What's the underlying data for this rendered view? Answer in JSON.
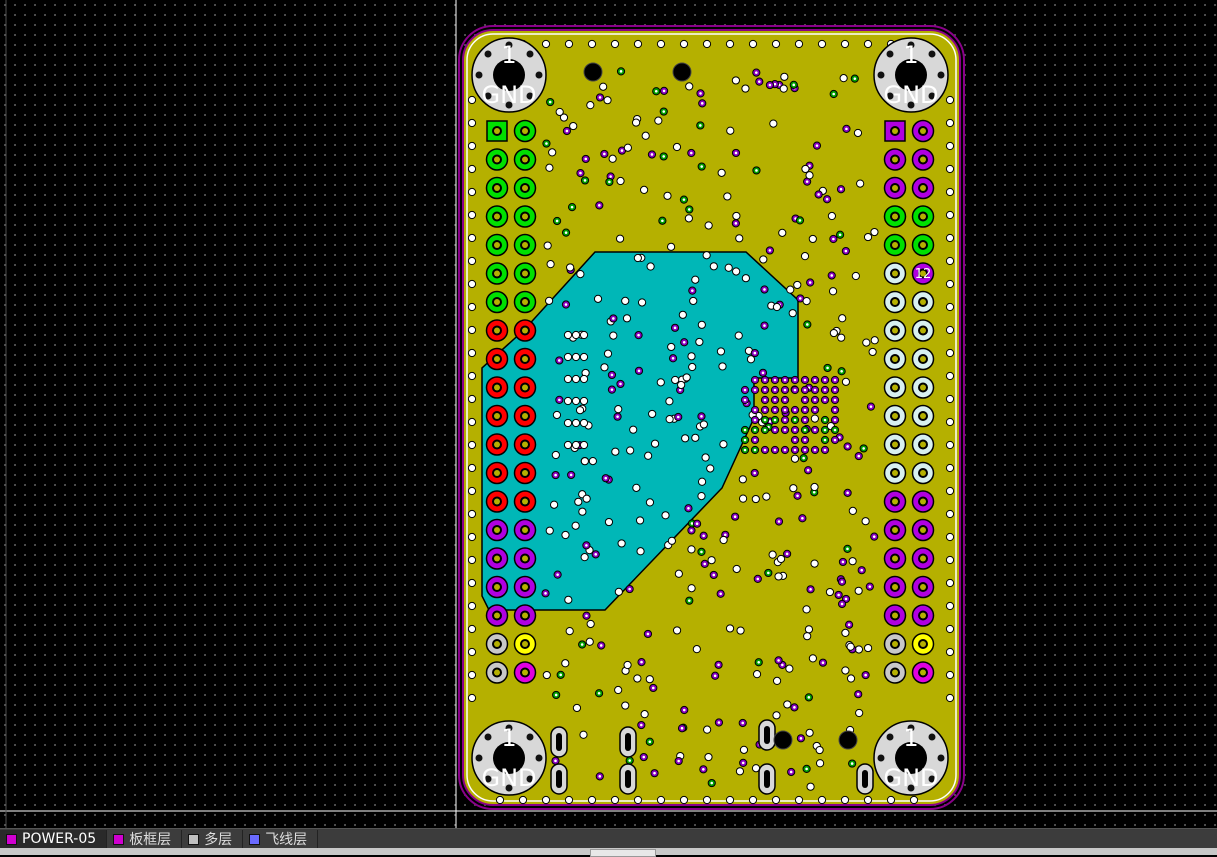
{
  "pcb": {
    "board_color": "#b5b000",
    "copper_pour_color": "#00b7b7",
    "outline_color": "#8a008a",
    "mount_hole_label_top": "1",
    "mount_hole_label_bottom": "GND",
    "pin_marker_label": "12"
  },
  "pin_headers": {
    "left_colors": [
      "#00e000",
      "#00e000",
      "#00e000",
      "#00e000",
      "#00e000",
      "#00e000",
      "#00e000",
      "#ff0000",
      "#ff0000",
      "#ff0000",
      "#ff0000",
      "#ff0000",
      "#ff0000",
      "#ff0000",
      "#b000e0",
      "#b000e0",
      "#b000e0",
      "#b000e0",
      "#c8c8c8",
      "#c8c8c8"
    ],
    "right_colors": [
      "#b000e0",
      "#b000e0",
      "#b000e0",
      "#00e000",
      "#00e000",
      "#d8f0f0",
      "#d8f0f0",
      "#d8f0f0",
      "#d8f0f0",
      "#d8f0f0",
      "#d8f0f0",
      "#d8f0f0",
      "#d8f0f0",
      "#b000e0",
      "#b000e0",
      "#b000e0",
      "#b000e0",
      "#b000e0",
      "#c8c8c8",
      "#c8c8c8"
    ]
  },
  "layers": [
    {
      "label": "POWER-05",
      "color": "#d000d0",
      "active": true
    },
    {
      "label": "板框层",
      "color": "#d000d0",
      "active": false
    },
    {
      "label": "多层",
      "color": "#c0c0c0",
      "active": false
    },
    {
      "label": "飞线层",
      "color": "#6a6aff",
      "active": false
    }
  ]
}
